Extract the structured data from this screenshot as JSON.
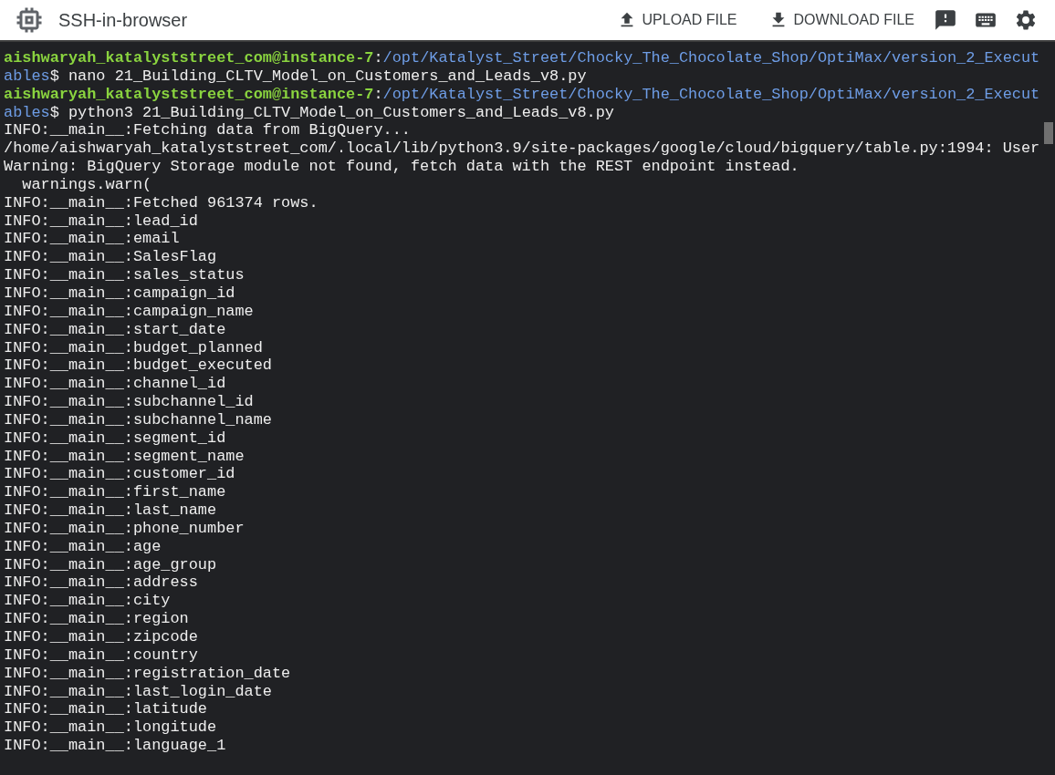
{
  "header": {
    "title": "SSH-in-browser",
    "actions": [
      {
        "kind": "upload",
        "label": "UPLOAD FILE"
      },
      {
        "kind": "download",
        "label": "DOWNLOAD FILE"
      }
    ],
    "icon_buttons": [
      {
        "kind": "feedback"
      },
      {
        "kind": "keyboard"
      },
      {
        "kind": "settings"
      }
    ]
  },
  "terminal": {
    "lines": [
      {
        "segments": [
          {
            "kind": "user",
            "text": "aishwaryah_katalyststreet_com@instance-7"
          },
          {
            "kind": "plain",
            "text": ":"
          },
          {
            "kind": "path",
            "text": "/opt/Katalyst_Street/Chocky_The_Chocolate_Shop/OptiMax/version_2_Execut"
          }
        ]
      },
      {
        "segments": [
          {
            "kind": "path",
            "text": "ables"
          },
          {
            "kind": "plain",
            "text": "$ nano 21_Building_CLTV_Model_on_Customers_and_Leads_v8.py"
          }
        ]
      },
      {
        "segments": [
          {
            "kind": "user",
            "text": "aishwaryah_katalyststreet_com@instance-7"
          },
          {
            "kind": "plain",
            "text": ":"
          },
          {
            "kind": "path",
            "text": "/opt/Katalyst_Street/Chocky_The_Chocolate_Shop/OptiMax/version_2_Execut"
          }
        ]
      },
      {
        "segments": [
          {
            "kind": "path",
            "text": "ables"
          },
          {
            "kind": "plain",
            "text": "$ python3 21_Building_CLTV_Model_on_Customers_and_Leads_v8.py"
          }
        ]
      },
      {
        "segments": [
          {
            "kind": "plain",
            "text": "INFO:__main__:Fetching data from BigQuery..."
          }
        ]
      },
      {
        "segments": [
          {
            "kind": "plain",
            "text": "/home/aishwaryah_katalyststreet_com/.local/lib/python3.9/site-packages/google/cloud/bigquery/table.py:1994: User"
          }
        ]
      },
      {
        "segments": [
          {
            "kind": "plain",
            "text": "Warning: BigQuery Storage module not found, fetch data with the REST endpoint instead."
          }
        ]
      },
      {
        "segments": [
          {
            "kind": "plain",
            "text": "  warnings.warn("
          }
        ]
      },
      {
        "segments": [
          {
            "kind": "plain",
            "text": "INFO:__main__:Fetched 961374 rows."
          }
        ]
      },
      {
        "segments": [
          {
            "kind": "plain",
            "text": "INFO:__main__:lead_id"
          }
        ]
      },
      {
        "segments": [
          {
            "kind": "plain",
            "text": "INFO:__main__:email"
          }
        ]
      },
      {
        "segments": [
          {
            "kind": "plain",
            "text": "INFO:__main__:SalesFlag"
          }
        ]
      },
      {
        "segments": [
          {
            "kind": "plain",
            "text": "INFO:__main__:sales_status"
          }
        ]
      },
      {
        "segments": [
          {
            "kind": "plain",
            "text": "INFO:__main__:campaign_id"
          }
        ]
      },
      {
        "segments": [
          {
            "kind": "plain",
            "text": "INFO:__main__:campaign_name"
          }
        ]
      },
      {
        "segments": [
          {
            "kind": "plain",
            "text": "INFO:__main__:start_date"
          }
        ]
      },
      {
        "segments": [
          {
            "kind": "plain",
            "text": "INFO:__main__:budget_planned"
          }
        ]
      },
      {
        "segments": [
          {
            "kind": "plain",
            "text": "INFO:__main__:budget_executed"
          }
        ]
      },
      {
        "segments": [
          {
            "kind": "plain",
            "text": "INFO:__main__:channel_id"
          }
        ]
      },
      {
        "segments": [
          {
            "kind": "plain",
            "text": "INFO:__main__:subchannel_id"
          }
        ]
      },
      {
        "segments": [
          {
            "kind": "plain",
            "text": "INFO:__main__:subchannel_name"
          }
        ]
      },
      {
        "segments": [
          {
            "kind": "plain",
            "text": "INFO:__main__:segment_id"
          }
        ]
      },
      {
        "segments": [
          {
            "kind": "plain",
            "text": "INFO:__main__:segment_name"
          }
        ]
      },
      {
        "segments": [
          {
            "kind": "plain",
            "text": "INFO:__main__:customer_id"
          }
        ]
      },
      {
        "segments": [
          {
            "kind": "plain",
            "text": "INFO:__main__:first_name"
          }
        ]
      },
      {
        "segments": [
          {
            "kind": "plain",
            "text": "INFO:__main__:last_name"
          }
        ]
      },
      {
        "segments": [
          {
            "kind": "plain",
            "text": "INFO:__main__:phone_number"
          }
        ]
      },
      {
        "segments": [
          {
            "kind": "plain",
            "text": "INFO:__main__:age"
          }
        ]
      },
      {
        "segments": [
          {
            "kind": "plain",
            "text": "INFO:__main__:age_group"
          }
        ]
      },
      {
        "segments": [
          {
            "kind": "plain",
            "text": "INFO:__main__:address"
          }
        ]
      },
      {
        "segments": [
          {
            "kind": "plain",
            "text": "INFO:__main__:city"
          }
        ]
      },
      {
        "segments": [
          {
            "kind": "plain",
            "text": "INFO:__main__:region"
          }
        ]
      },
      {
        "segments": [
          {
            "kind": "plain",
            "text": "INFO:__main__:zipcode"
          }
        ]
      },
      {
        "segments": [
          {
            "kind": "plain",
            "text": "INFO:__main__:country"
          }
        ]
      },
      {
        "segments": [
          {
            "kind": "plain",
            "text": "INFO:__main__:registration_date"
          }
        ]
      },
      {
        "segments": [
          {
            "kind": "plain",
            "text": "INFO:__main__:last_login_date"
          }
        ]
      },
      {
        "segments": [
          {
            "kind": "plain",
            "text": "INFO:__main__:latitude"
          }
        ]
      },
      {
        "segments": [
          {
            "kind": "plain",
            "text": "INFO:__main__:longitude"
          }
        ]
      },
      {
        "segments": [
          {
            "kind": "plain",
            "text": "INFO:__main__:language_1"
          }
        ]
      }
    ]
  }
}
